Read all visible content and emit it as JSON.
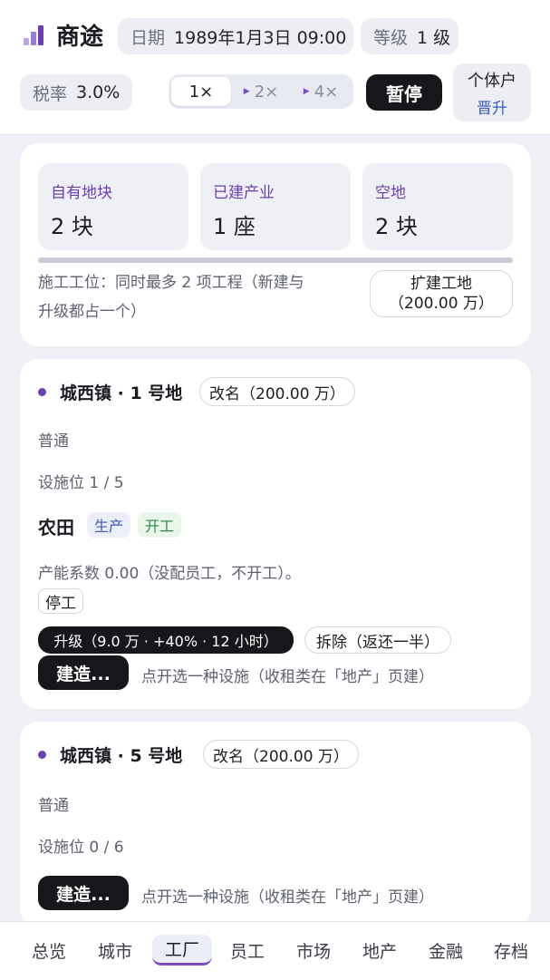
{
  "header": {
    "app_title": "商途",
    "date_label": "日期",
    "date_value": "1989年1月3日 09:00",
    "level_label": "等级",
    "level_value": "1 级",
    "tax_label": "税率",
    "tax_value": "3.0%",
    "speeds": [
      "1×",
      "2×",
      "4×"
    ],
    "pause_label": "暂停",
    "entity_type": "个体户",
    "entity_action": "晋升"
  },
  "summary": {
    "stats": [
      {
        "label": "自有地块",
        "value": "2 块"
      },
      {
        "label": "已建产业",
        "value": "1 座"
      },
      {
        "label": "空地",
        "value": "2 块"
      }
    ],
    "construction_desc_line1": "施工工位：同时最多 2 项工程（新建与",
    "construction_desc_line2": "升级都占一个）",
    "expand_line1": "扩建工地",
    "expand_line2": "（200.00 万）"
  },
  "plots": [
    {
      "title": "城西镇 · 1 号地",
      "rename_label": "改名（200.00 万）",
      "grade": "普通",
      "slots": "设施位 1 / 5",
      "facility": {
        "name": "农田",
        "tags": [
          "生产",
          "开工"
        ],
        "capacity_text": "产能系数 0.00（没配员工，不开工）。",
        "stop_label": "停工",
        "upgrade_label": "升级（9.0 万 · +40% · 12 小时）",
        "demolish_label": "拆除（返还一半）"
      },
      "build_label": "建造...",
      "build_hint": "点开选一种设施（收租类在「地产」页建）"
    },
    {
      "title": "城西镇 · 5 号地",
      "rename_label": "改名（200.00 万）",
      "grade": "普通",
      "slots": "设施位 0 / 6",
      "build_label": "建造...",
      "build_hint": "点开选一种设施（收租类在「地产」页建）"
    }
  ],
  "nav": [
    "总览",
    "城市",
    "工厂",
    "员工",
    "市场",
    "地产",
    "金融",
    "存档"
  ],
  "colors": {
    "accent": "#6b3fb3",
    "dark": "#16161b",
    "link": "#3a5bc0"
  }
}
